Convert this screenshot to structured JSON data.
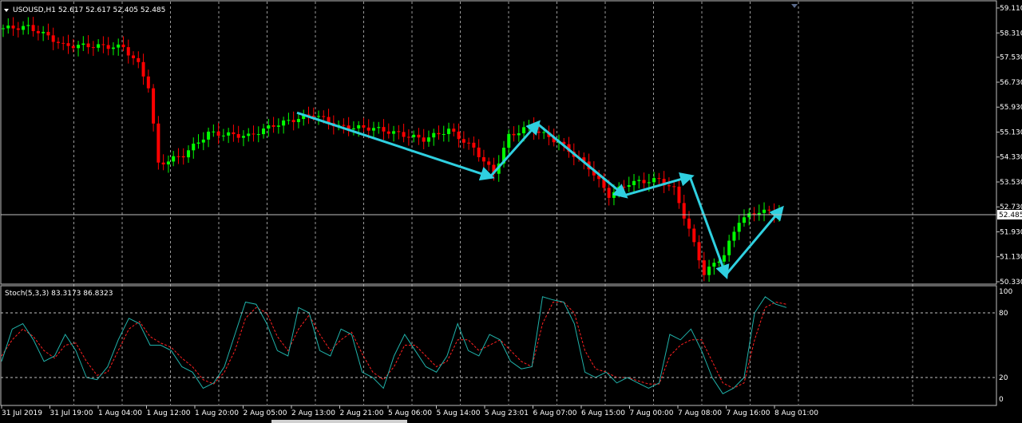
{
  "colors": {
    "background": "#000000",
    "bull_candle": "#00ff00",
    "bear_candle": "#ff0000",
    "grid": "#c0c0c0",
    "arrow": "#2fd0e0",
    "stoch_main": "#20b2aa",
    "stoch_signal": "#ff2020",
    "price_line": "#c0c0c0"
  },
  "main_panel": {
    "header": "USOUSD,H1  52.617 52.617 52.405 52.485",
    "header_icon": "triangle-down-icon",
    "current_price": "52.485",
    "price_ticks": [
      "59.110",
      "58.310",
      "57.530",
      "56.730",
      "55.930",
      "55.130",
      "54.330",
      "53.530",
      "52.730",
      "51.930",
      "51.130",
      "50.330"
    ]
  },
  "stoch_panel": {
    "header": "Stoch(5,3,3) 83.3173 86.8323",
    "level_ticks": [
      "100",
      "80",
      "20",
      "0"
    ]
  },
  "time_axis": {
    "ticks": [
      "31 Jul 2019",
      "31 Jul 19:00",
      "1 Aug 04:00",
      "1 Aug 12:00",
      "1 Aug 20:00",
      "2 Aug 05:00",
      "2 Aug 13:00",
      "2 Aug 21:00",
      "5 Aug 06:00",
      "5 Aug 14:00",
      "5 Aug 23:01",
      "6 Aug 07:00",
      "6 Aug 15:00",
      "7 Aug 00:00",
      "7 Aug 08:00",
      "7 Aug 16:00",
      "8 Aug 01:00"
    ]
  },
  "chart_data": {
    "type": "candlestick",
    "ylim": [
      50.33,
      59.11
    ],
    "zigzag_arrows": [
      [
        55.75,
        53.7
      ],
      [
        53.7,
        55.4
      ],
      [
        55.4,
        53.1
      ],
      [
        53.1,
        53.7
      ],
      [
        53.7,
        50.55
      ],
      [
        50.55,
        52.65
      ]
    ],
    "stoch_main_values": [
      35,
      65,
      70,
      55,
      35,
      40,
      60,
      45,
      20,
      18,
      30,
      55,
      75,
      70,
      50,
      50,
      45,
      30,
      25,
      10,
      15,
      30,
      60,
      90,
      88,
      70,
      45,
      40,
      85,
      80,
      45,
      40,
      65,
      60,
      25,
      20,
      10,
      40,
      60,
      45,
      30,
      25,
      40,
      70,
      45,
      40,
      60,
      55,
      35,
      28,
      30,
      95,
      92,
      90,
      70,
      25,
      20,
      25,
      15,
      20,
      15,
      10,
      15,
      60,
      55,
      65,
      45,
      20,
      5,
      10,
      20,
      80,
      95,
      88,
      85
    ],
    "stoch_signal_values": [
      40,
      55,
      65,
      58,
      45,
      38,
      50,
      52,
      35,
      22,
      25,
      45,
      65,
      72,
      58,
      52,
      48,
      38,
      30,
      18,
      14,
      25,
      45,
      75,
      85,
      80,
      58,
      45,
      65,
      78,
      60,
      45,
      55,
      62,
      42,
      25,
      18,
      30,
      50,
      50,
      40,
      30,
      35,
      55,
      55,
      45,
      50,
      55,
      45,
      35,
      30,
      70,
      90,
      90,
      80,
      45,
      28,
      25,
      20,
      20,
      17,
      14,
      14,
      40,
      50,
      55,
      55,
      35,
      15,
      10,
      15,
      55,
      85,
      90,
      88
    ]
  }
}
